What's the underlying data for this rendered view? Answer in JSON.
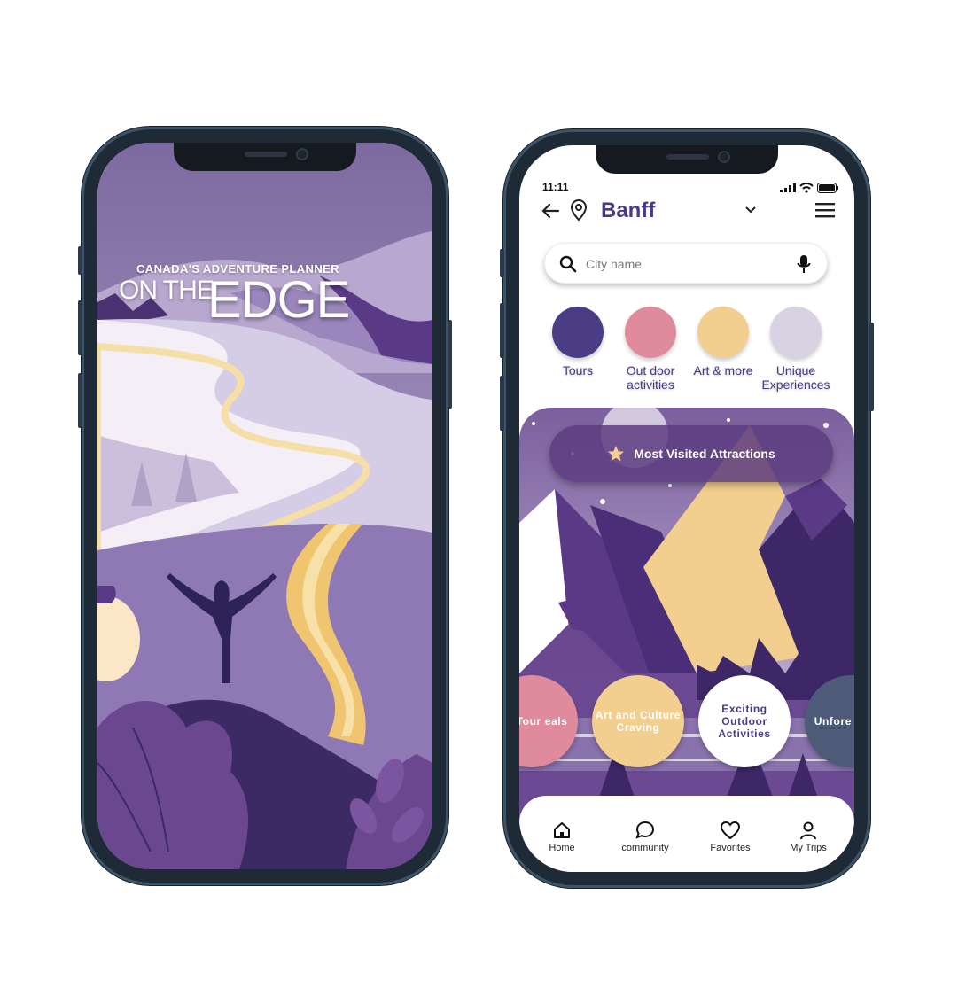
{
  "splash": {
    "tagline": "CANADA'S ADVENTURE PLANNER",
    "title_part1": "ON THE",
    "title_part2": "EDGE"
  },
  "app": {
    "status_time": "11:11",
    "city": "Banff",
    "search": {
      "placeholder": "City name"
    },
    "categories": [
      {
        "label": "Tours",
        "color": "#4a3d85"
      },
      {
        "label": "Out door activities",
        "color": "#e08a9e"
      },
      {
        "label": "Art & more",
        "color": "#f3cf8f"
      },
      {
        "label": "Unique Experiences",
        "color": "#d8d2e2"
      }
    ],
    "most_visited": "Most Visited Attractions",
    "bubbles": [
      {
        "label": "est Tour eals",
        "color": "#e08a9e"
      },
      {
        "label": "Art and Culture Craving",
        "color": "#f3cf8f"
      },
      {
        "label": "Exciting Outdoor Activities",
        "color": "#ffffff"
      },
      {
        "label": "Unfore Exper",
        "color": "#4d5a78"
      }
    ],
    "tabs": [
      "Home",
      "community",
      "Favorites",
      "My Trips"
    ]
  }
}
